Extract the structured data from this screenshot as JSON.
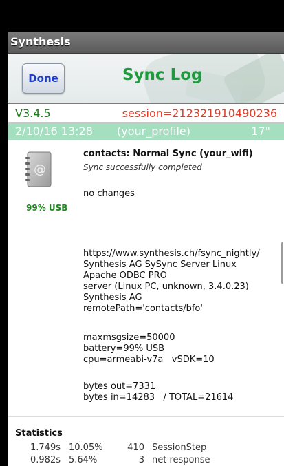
{
  "app": {
    "title": "Synthesis"
  },
  "header": {
    "done_label": "Done",
    "title": "Sync Log"
  },
  "log": {
    "version": "V3.4.5",
    "session": "session=212321910490236",
    "date": "2/10/16  13:28",
    "profile": "(your_profile)",
    "duration": "17\"",
    "battery_label": "99% USB",
    "sync_title": "contacts: Normal Sync  (your_wifi)",
    "sync_status": "Sync successfully completed",
    "changes": "no changes",
    "server_info": "https://www.synthesis.ch/fsync_nightly/\nSynthesis AG SySync Server Linux\nApache ODBC PRO\nserver (Linux PC, unknown, 3.4.0.23)\nSynthesis AG\nremotePath='contacts/bfo'",
    "device_info": "maxmsgsize=50000\nbattery=99% USB\ncpu=armeabi-v7a   vSDK=10",
    "bytes_info": "bytes out=7331\nbytes in=14283   / TOTAL=21614"
  },
  "statistics": {
    "title": "Statistics",
    "rows": [
      {
        "time": "1.749s",
        "percent": "10.05%",
        "count": "410",
        "name": "SessionStep"
      },
      {
        "time": "0.982s",
        "percent": "5.64%",
        "count": "3",
        "name": "net response"
      }
    ]
  },
  "colors": {
    "version": "#1b7d1b",
    "session": "#e23b25",
    "profile_bar": "#a4e0bf",
    "title_green": "#1f9a3e",
    "done_blue": "#1f3ec8"
  },
  "icons": [
    "address-book-icon"
  ]
}
